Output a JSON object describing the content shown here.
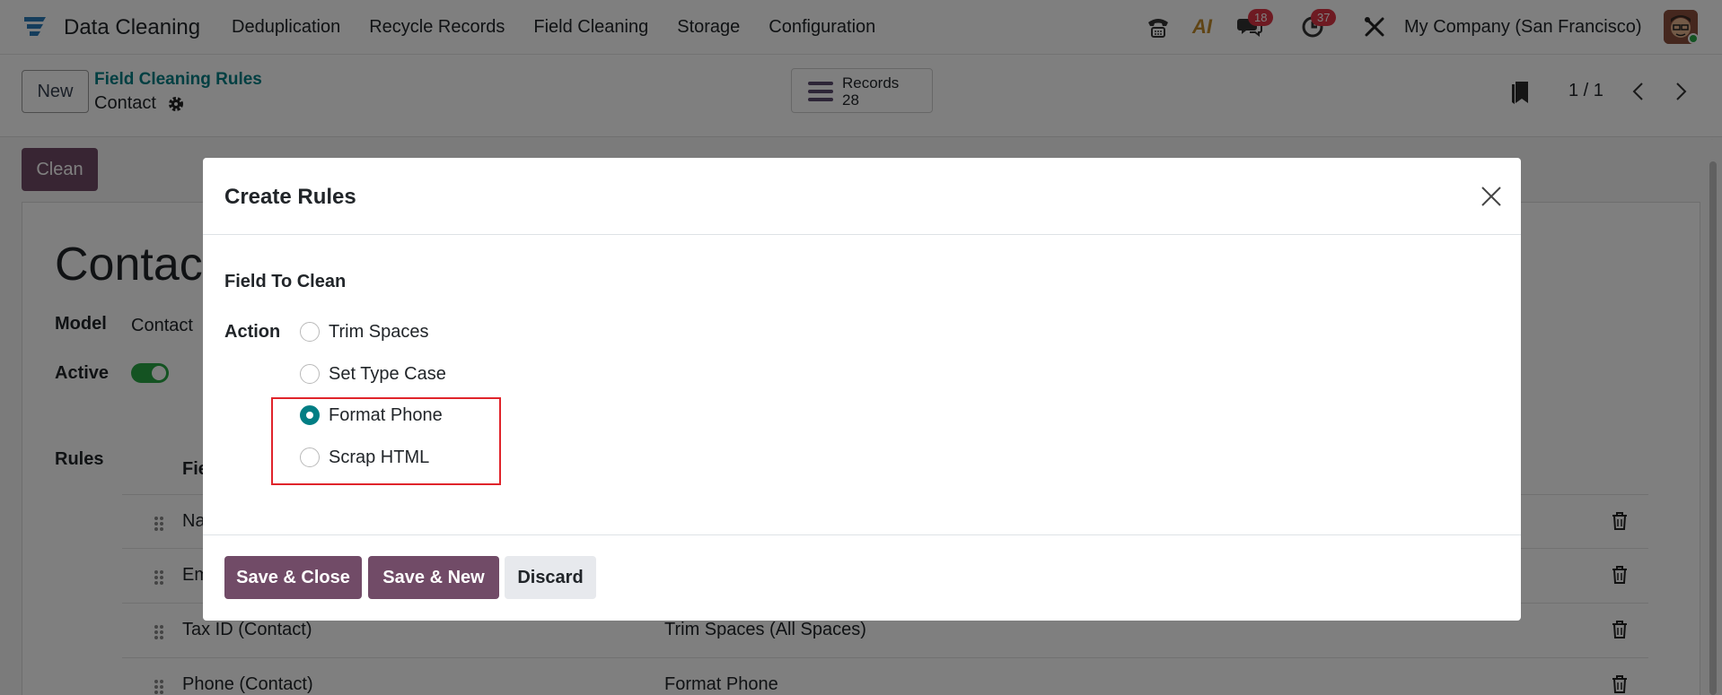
{
  "navbar": {
    "app_name": "Data Cleaning",
    "menu": [
      "Deduplication",
      "Recycle Records",
      "Field Cleaning",
      "Storage",
      "Configuration"
    ],
    "messages_count": "18",
    "activities_count": "37",
    "ai_label": "AI",
    "company": "My Company (San Francisco)"
  },
  "control_panel": {
    "new_label": "New",
    "breadcrumb": "Field Cleaning Rules",
    "record_name": "Contact",
    "records_label": "Records",
    "records_count": "28",
    "pager": "1 / 1"
  },
  "form": {
    "clean_label": "Clean",
    "title": "Contact",
    "model_label": "Model",
    "model_value": "Contact",
    "active_label": "Active",
    "active": true,
    "rules_label": "Rules",
    "rules_col_field": "Field",
    "rules": [
      {
        "field": "Name (Contact)",
        "action": ""
      },
      {
        "field": "Email (Contact)",
        "action": ""
      },
      {
        "field": "Tax ID (Contact)",
        "action": "Trim Spaces (All Spaces)"
      },
      {
        "field": "Phone (Contact)",
        "action": "Format Phone"
      }
    ]
  },
  "dialog": {
    "title": "Create Rules",
    "field_to_clean_label": "Field To Clean",
    "action_label": "Action",
    "options": [
      {
        "label": "Trim Spaces",
        "checked": false
      },
      {
        "label": "Set Type Case",
        "checked": false
      },
      {
        "label": "Format Phone",
        "checked": true
      },
      {
        "label": "Scrap HTML",
        "checked": false
      }
    ],
    "save_close_label": "Save & Close",
    "save_new_label": "Save & New",
    "discard_label": "Discard"
  },
  "colors": {
    "primary": "#714b67",
    "teal": "#017e84",
    "highlight": "#e0242b",
    "badge": "#dc3545"
  }
}
